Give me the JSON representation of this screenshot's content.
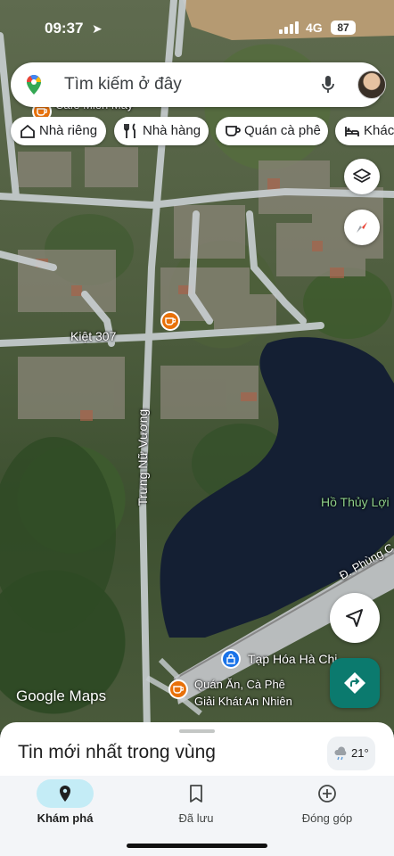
{
  "status_bar": {
    "time": "09:37",
    "network": "4G",
    "battery": "87"
  },
  "search": {
    "placeholder": "Tìm kiếm ở đây"
  },
  "chips": [
    {
      "label": "Nhà riêng",
      "icon": "home-icon"
    },
    {
      "label": "Nhà hàng",
      "icon": "restaurant-icon"
    },
    {
      "label": "Quán cà phê",
      "icon": "cafe-icon"
    },
    {
      "label": "Khác",
      "icon": "bed-icon"
    }
  ],
  "map": {
    "labels": {
      "top_poi": "Café Miền Mây",
      "alley": "Kiệt 307",
      "main_road": "Trưng Nữ Vương",
      "lake": "Hồ Thủy Lợi",
      "right_road": "Đ. Phùng C",
      "shop": "Tạp Hóa Hà Chi",
      "cafe_line1": "Quán Ăn, Cà Phê",
      "cafe_line2": "Giải Khát An Nhiên"
    },
    "attribution": "Google Maps",
    "poi_color_food": "#e8710a",
    "poi_color_shop": "#1a73e8",
    "water_color": "#141f33"
  },
  "sheet": {
    "title": "Tin mới nhất trong vùng",
    "temperature": "21°"
  },
  "nav": [
    {
      "label": "Khám phá",
      "icon": "explore-pin-icon",
      "active": true
    },
    {
      "label": "Đã lưu",
      "icon": "bookmark-icon",
      "active": false
    },
    {
      "label": "Đóng góp",
      "icon": "add-circle-icon",
      "active": false
    }
  ]
}
